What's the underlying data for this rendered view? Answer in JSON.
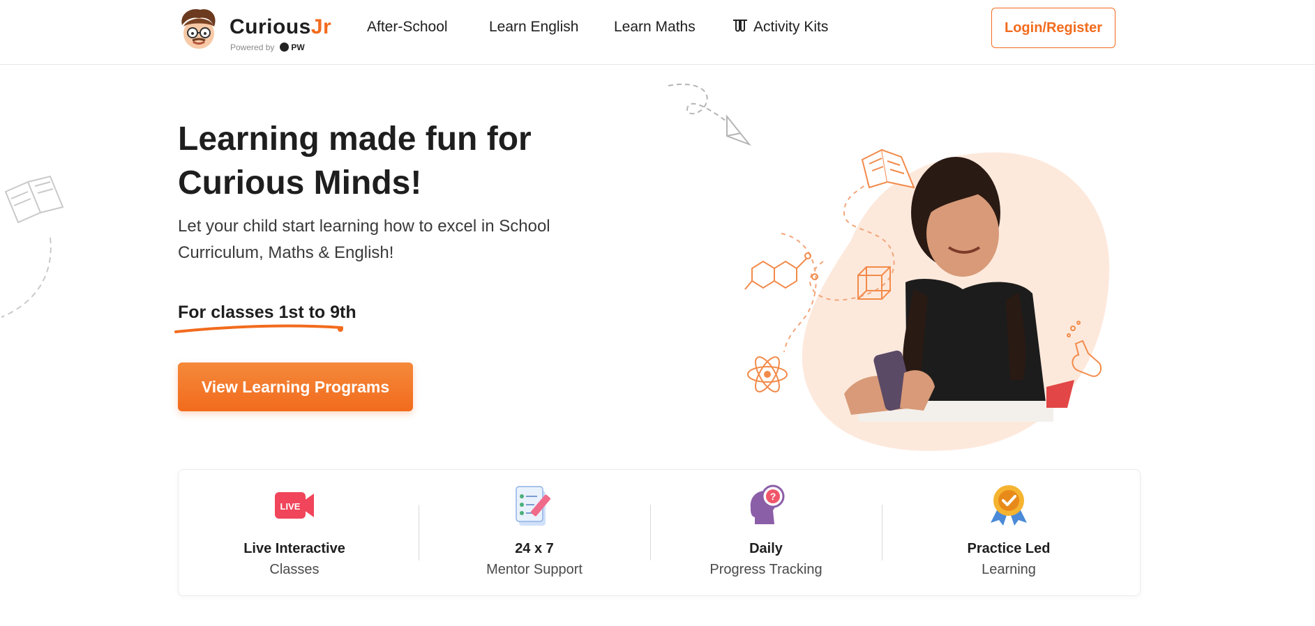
{
  "header": {
    "brand": {
      "name_main": "Curious",
      "name_accent": "Jr",
      "powered_by": "Powered by",
      "partner": "PW"
    },
    "nav": [
      {
        "label": "After-School"
      },
      {
        "label": "Learn English"
      },
      {
        "label": "Learn Maths"
      },
      {
        "label": "Activity Kits",
        "icon": "lab-tubes-icon"
      }
    ],
    "login_label": "Login/Register"
  },
  "hero": {
    "title": "Learning made fun for Curious Minds!",
    "subtitle": "Let your child start learning how to excel in School Curriculum, Maths & English!",
    "classes": "For classes 1st to 9th",
    "cta_label": "View Learning Programs",
    "image_icons": [
      "open-book-icon",
      "molecule-icon",
      "cube-icon",
      "atom-icon",
      "flask-icon",
      "paper-plane-icon"
    ]
  },
  "features": [
    {
      "title": "Live Interactive",
      "subtitle": "Classes",
      "icon": "live-camera-icon",
      "badge": "LIVE"
    },
    {
      "title": "24 x 7",
      "subtitle": "Mentor Support",
      "icon": "checklist-pencil-icon"
    },
    {
      "title": "Daily",
      "subtitle": "Progress Tracking",
      "icon": "head-question-icon"
    },
    {
      "title": "Practice Led",
      "subtitle": "Learning",
      "icon": "award-badge-icon"
    }
  ],
  "colors": {
    "accent": "#f26b1d",
    "text": "#1e1e1e",
    "hero_blob": "#fde9dc",
    "live_red": "#f0455a"
  }
}
